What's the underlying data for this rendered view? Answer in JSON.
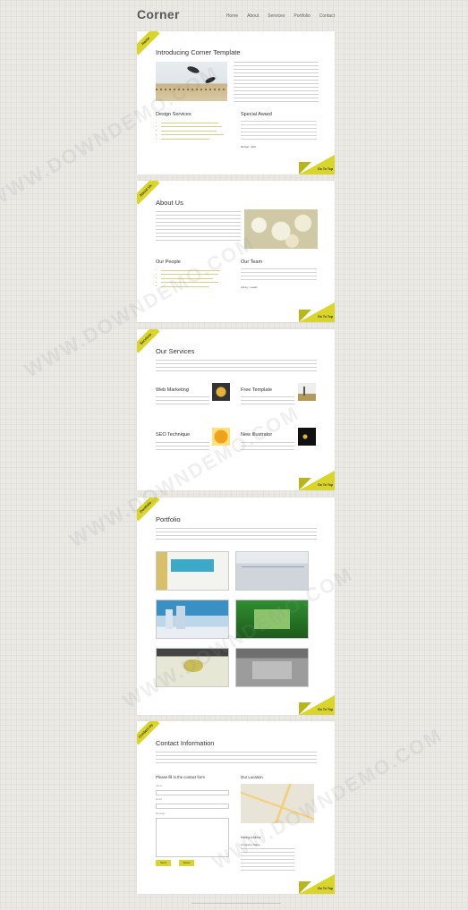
{
  "header": {
    "logo": "Corner",
    "nav": [
      "Home",
      "About",
      "Services",
      "Portfolio",
      "Contact"
    ]
  },
  "intro": {
    "tab": "Home",
    "title": "Introducing Corner Template",
    "design_title": "Design Services",
    "award_title": "Special Award",
    "award_sig": "Michael - CEO",
    "top": "Go To Top"
  },
  "about": {
    "tab": "About Us",
    "title": "About Us",
    "people_title": "Our People",
    "team_title": "Our Team",
    "team_sig": "Johnny - Leader",
    "top": "Go To Top"
  },
  "services": {
    "tab": "Services",
    "title": "Our Services",
    "items": [
      "Web Marketing",
      "Free Template",
      "SEO Technique",
      "New Illustrator"
    ],
    "top": "Go To Top"
  },
  "portfolio": {
    "tab": "Portfolio",
    "title": "Portfolio",
    "top": "Go To Top"
  },
  "contact": {
    "tab": "Contact Us",
    "title": "Contact Information",
    "form_title": "Please fill in the contact form",
    "name": "Name",
    "email": "Email",
    "message": "Message",
    "send": "Send",
    "reset": "Reset",
    "location": "Our Location",
    "mailing": "Mailing Address",
    "company": "Company Name",
    "top": "Go To Top"
  },
  "watermark": "WWW.DOWNDEMO.COM"
}
